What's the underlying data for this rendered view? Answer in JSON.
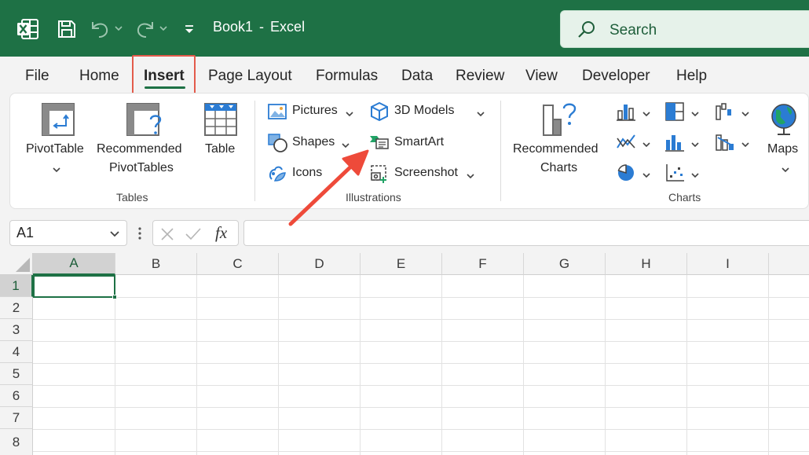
{
  "titlebar": {
    "book_name": "Book1",
    "separator": "-",
    "app_name": "Excel",
    "search_label": "Search"
  },
  "tabs": [
    {
      "label": "File"
    },
    {
      "label": "Home"
    },
    {
      "label": "Insert",
      "active": true
    },
    {
      "label": "Page Layout"
    },
    {
      "label": "Formulas"
    },
    {
      "label": "Data"
    },
    {
      "label": "Review"
    },
    {
      "label": "View"
    },
    {
      "label": "Developer"
    },
    {
      "label": "Help"
    }
  ],
  "ribbon": {
    "tables": {
      "group_label": "Tables",
      "pivottable": "PivotTable",
      "recommended_line1": "Recommended",
      "recommended_line2": "PivotTables",
      "table": "Table"
    },
    "illustrations": {
      "group_label": "Illustrations",
      "pictures": "Pictures",
      "shapes": "Shapes",
      "icons": "Icons",
      "models": "3D Models",
      "smartart": "SmartArt",
      "screenshot": "Screenshot"
    },
    "charts": {
      "group_label": "Charts",
      "recommended_line1": "Recommended",
      "recommended_line2": "Charts",
      "maps": "Maps"
    }
  },
  "formula_bar": {
    "name_box": "A1",
    "fx": "fx",
    "value": ""
  },
  "grid": {
    "columns": [
      "A",
      "B",
      "C",
      "D",
      "E",
      "F",
      "G",
      "H",
      "I"
    ],
    "rows": [
      "1",
      "2",
      "3",
      "4",
      "5",
      "6",
      "7",
      "8"
    ],
    "active_cell": "A1"
  },
  "colors": {
    "title_bar": "#1e7145",
    "highlight_box": "#e35b4b",
    "annotation_arrow": "#ee4a3a",
    "accent": "#1e7145"
  }
}
